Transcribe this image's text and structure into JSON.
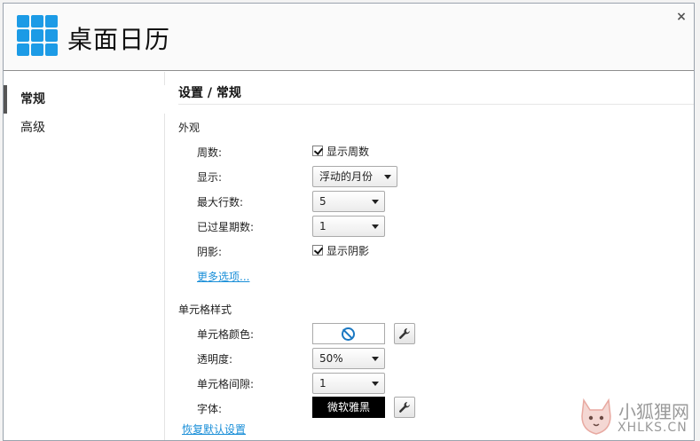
{
  "app": {
    "title": "桌面日历",
    "close_glyph": "×",
    "logo_icon": "calendar-grid-logo",
    "accent_color": "#1c9be6"
  },
  "sidebar": {
    "items": [
      {
        "label": "常规",
        "active": true
      },
      {
        "label": "高级",
        "active": false
      }
    ]
  },
  "main": {
    "page_title": "设置 / 常规",
    "appearance": {
      "heading": "外观",
      "week_number_label": "周数:",
      "week_number_checkbox": "显示周数",
      "display_label": "显示:",
      "display_value": "浮动的月份",
      "max_rows_label": "最大行数:",
      "max_rows_value": "5",
      "past_weeks_label": "已过星期数:",
      "past_weeks_value": "1",
      "shadow_label": "阴影:",
      "shadow_checkbox": "显示阴影",
      "more_options_link": "更多选项..."
    },
    "cell_style": {
      "heading": "单元格样式",
      "cell_color_label": "单元格颜色:",
      "cell_color_icon": "no-color-icon",
      "opacity_label": "透明度:",
      "opacity_value": "50%",
      "cell_spacing_label": "单元格间隙:",
      "cell_spacing_value": "1",
      "font_label": "字体:",
      "font_value": "微软雅黑",
      "restore_defaults_link": "恢复默认设置"
    }
  },
  "watermark": {
    "main": "小狐狸网",
    "sub": "XHLKS.CN"
  }
}
